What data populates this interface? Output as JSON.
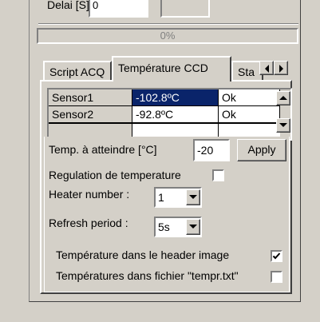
{
  "top": {
    "delay_label": "Delai [S]",
    "delay_value": "0",
    "progress_text": "0%",
    "progress_percent": 0
  },
  "tabs": [
    {
      "label": "Script ACQ"
    },
    {
      "label": "Température CCD"
    },
    {
      "label": "Sta"
    }
  ],
  "sensors": [
    {
      "name": "Sensor1",
      "temp": "-102.8ºC",
      "status": "Ok"
    },
    {
      "name": "Sensor2",
      "temp": "-92.8ºC",
      "status": "Ok"
    }
  ],
  "form": {
    "target_label": "Temp. à atteindre [°C]",
    "target_value": "-20",
    "apply_label": "Apply",
    "regulation_label": "Regulation de temperature",
    "regulation_checked": false,
    "heater_label": "Heater number :",
    "heater_value": "1",
    "refresh_label": "Refresh period :",
    "refresh_value": "5s",
    "header_label": "Température dans le header image",
    "header_checked": true,
    "file_label": "Températures dans fichier \"tempr.txt\"",
    "file_checked": false
  },
  "colors": {
    "selection": "#0a246a",
    "face": "#d4d0c8"
  }
}
